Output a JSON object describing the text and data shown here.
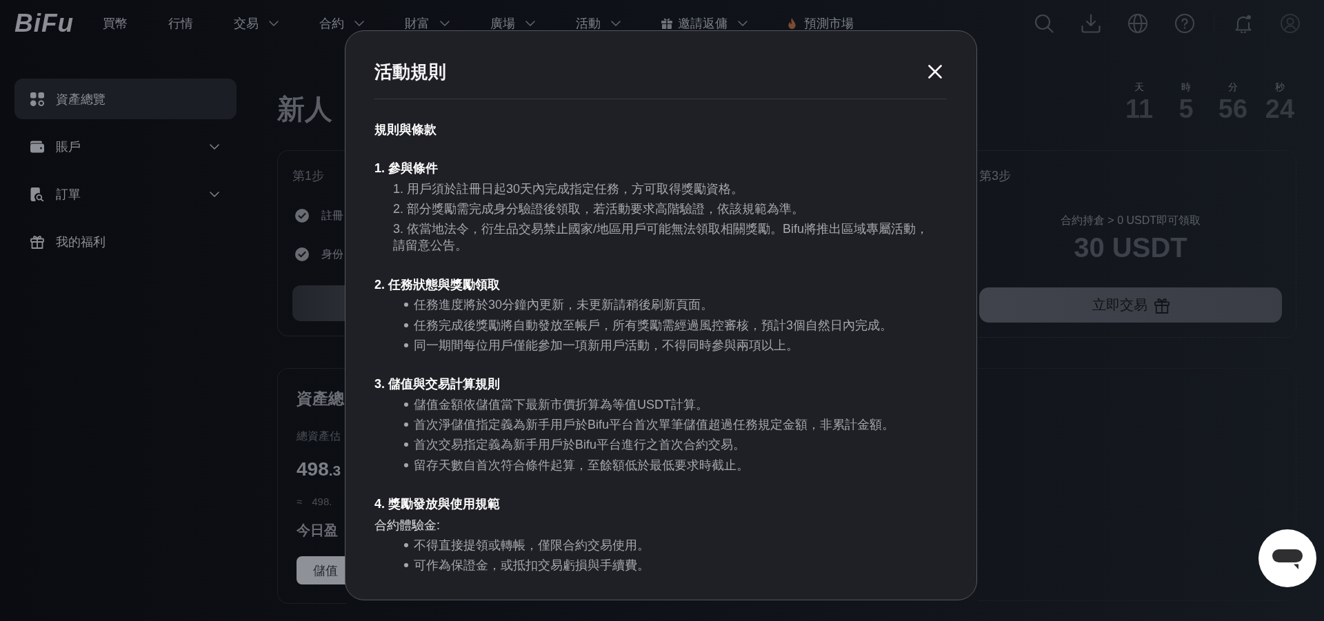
{
  "nav": {
    "logo": "BiFu",
    "items": [
      {
        "label": "買幣",
        "kind": "link"
      },
      {
        "label": "行情",
        "kind": "link"
      },
      {
        "label": "交易",
        "kind": "menu"
      },
      {
        "label": "合約",
        "kind": "menu"
      },
      {
        "label": "財富",
        "kind": "menu"
      },
      {
        "label": "廣場",
        "kind": "menu"
      },
      {
        "label": "活動",
        "kind": "menu"
      },
      {
        "label": "邀請返傭",
        "kind": "gift_menu"
      },
      {
        "label": "預測市場",
        "kind": "hot_link"
      }
    ]
  },
  "sidebar": {
    "items": [
      {
        "label": "資產總覽",
        "kind": "link",
        "selected": true
      },
      {
        "label": "賬戶",
        "kind": "group",
        "selected": false
      },
      {
        "label": "訂單",
        "kind": "group",
        "selected": false
      },
      {
        "label": "我的福利",
        "kind": "link",
        "selected": false
      }
    ]
  },
  "page": {
    "title": "新人",
    "countdown": [
      {
        "unit": "天",
        "value": "11"
      },
      {
        "unit": "時",
        "value": "5"
      },
      {
        "unit": "分",
        "value": "56"
      },
      {
        "unit": "秒",
        "value": "24"
      }
    ]
  },
  "steps": [
    {
      "kind": "tasks",
      "label": "第1步",
      "tasks": [
        {
          "label": "註冊",
          "done": true
        },
        {
          "label": "身份",
          "done": true
        }
      ]
    },
    {
      "kind": "reward",
      "label": "第3步",
      "condition": "合約持倉 > 0 USDT即可領取",
      "reward": "30 USDT",
      "button": "立即交易"
    }
  ],
  "assets": {
    "title": "資產總",
    "label": "總資產估",
    "amount": {
      "integer": "498",
      "fraction": ".3"
    },
    "approx": {
      "sign": "≈",
      "value": "498."
    },
    "pnl_label": "今日盈",
    "button": "儲值"
  },
  "modal": {
    "title": "活動規則",
    "heading": "規則與條款",
    "sections": [
      {
        "title": "1. 參與條件",
        "kind": "numbered",
        "items": [
          "1. 用戶須於註冊日起30天內完成指定任務，方可取得獎勵資格。",
          "2. 部分獎勵需完成身分驗證後領取，若活動要求高階驗證，依該規範為準。",
          "3. 依當地法令，衍生品交易禁止國家/地區用戶可能無法領取相關獎勵。Bifu將推出區域專屬活動，請留意公告。"
        ]
      },
      {
        "title": "2. 任務狀態與獎勵領取",
        "kind": "bulleted",
        "items": [
          "任務進度將於30分鐘內更新，未更新請稍後刷新頁面。",
          "任務完成後獎勵將自動發放至帳戶，所有獎勵需經過風控審核，預計3個自然日內完成。",
          "同一期間每位用戶僅能參加一項新用戶活動，不得同時參與兩項以上。"
        ]
      },
      {
        "title": "3. 儲值與交易計算規則",
        "kind": "bulleted",
        "items": [
          "儲值金額依儲值當下最新市價折算為等值USDT計算。",
          "首次淨儲值指定義為新手用戶於Bifu平台首次單筆儲值超過任務規定金額，非累計金額。",
          "首次交易指定義為新手用戶於Bifu平台進行之首次合約交易。",
          "留存天數自首次符合條件起算，至餘額低於最低要求時截止。"
        ]
      },
      {
        "title": "4. 獎勵發放與使用規範",
        "kind": "bulleted",
        "intro": "合約體驗金:",
        "items": [
          "不得直接提領或轉帳，僅限合約交易使用。",
          "可作為保證金，或抵扣交易虧損與手續費。"
        ]
      }
    ]
  }
}
